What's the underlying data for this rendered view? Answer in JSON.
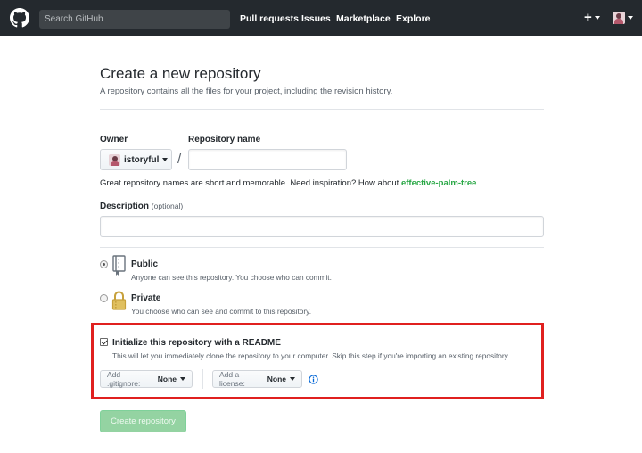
{
  "header": {
    "search_placeholder": "Search GitHub",
    "nav": [
      "Pull requests",
      "Issues",
      "Marketplace",
      "Explore"
    ],
    "plus_label": "+"
  },
  "page": {
    "title": "Create a new repository",
    "subtitle": "A repository contains all the files for your project, including the revision history."
  },
  "form": {
    "owner_label": "Owner",
    "owner_value": "istoryful",
    "slash": "/",
    "repo_name_label": "Repository name",
    "repo_name_value": "",
    "hint_prefix": "Great repository names are short and memorable. Need inspiration? How about ",
    "hint_suggestion": "effective-palm-tree",
    "hint_suffix": ".",
    "description_label": "Description",
    "description_optional": "(optional)",
    "description_value": "",
    "visibility": {
      "public_title": "Public",
      "public_desc": "Anyone can see this repository. You choose who can commit.",
      "private_title": "Private",
      "private_desc": "You choose who can see and commit to this repository.",
      "selected": "public"
    },
    "readme": {
      "checked": true,
      "title": "Initialize this repository with a README",
      "desc": "This will let you immediately clone the repository to your computer. Skip this step if you're importing an existing repository."
    },
    "gitignore_label": "Add .gitignore:",
    "gitignore_value": "None",
    "license_label": "Add a license:",
    "license_value": "None",
    "create_button": "Create repository"
  },
  "colors": {
    "header_bg": "#24292e",
    "highlight_border": "#e0201f",
    "suggestion": "#28a745",
    "create_button_bg": "#94d3a2",
    "info_icon": "#0366d6"
  }
}
